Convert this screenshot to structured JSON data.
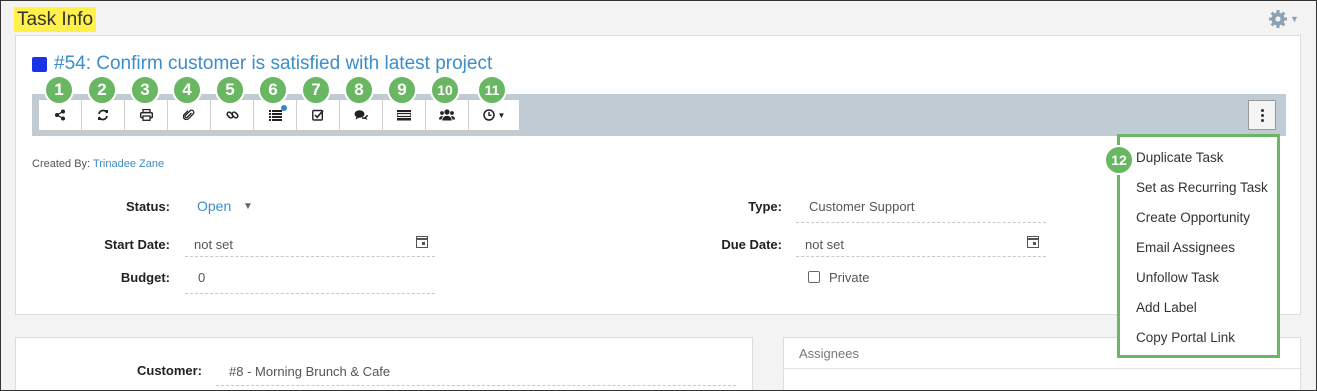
{
  "page": {
    "title": "Task Info"
  },
  "task": {
    "color": "#1a33e6",
    "title": "#54: Confirm customer is satisfied with latest project",
    "created_by_label": "Created By:",
    "created_by": "Trinadee Zane"
  },
  "toolbar": {
    "band_color": "#c0cbd4",
    "badge_color": "#6ab763",
    "buttons": [
      {
        "badge": "1",
        "icon": "share-icon"
      },
      {
        "badge": "2",
        "icon": "refresh-icon"
      },
      {
        "badge": "3",
        "icon": "print-icon"
      },
      {
        "badge": "4",
        "icon": "paperclip-icon"
      },
      {
        "badge": "5",
        "icon": "link-icon"
      },
      {
        "badge": "6",
        "icon": "list-icon"
      },
      {
        "badge": "7",
        "icon": "checkbox-icon"
      },
      {
        "badge": "8",
        "icon": "comments-icon"
      },
      {
        "badge": "9",
        "icon": "form-icon"
      },
      {
        "badge": "10",
        "icon": "users-icon"
      },
      {
        "badge": "11",
        "icon": "clock-dropdown-icon"
      }
    ]
  },
  "more_menu": {
    "badge": "12",
    "items": [
      "Duplicate Task",
      "Set as Recurring Task",
      "Create Opportunity",
      "Email Assignees",
      "Unfollow Task",
      "Add Label",
      "Copy Portal Link"
    ]
  },
  "fields": {
    "status_label": "Status:",
    "status_value": "Open",
    "start_label": "Start Date:",
    "start_value": "not set",
    "budget_label": "Budget:",
    "budget_value": "0",
    "type_label": "Type:",
    "type_value": "Customer Support",
    "due_label": "Due Date:",
    "due_value": "not set",
    "private_label": "Private"
  },
  "customer": {
    "label": "Customer:",
    "value": "#8 - Morning Brunch & Cafe"
  },
  "assignees": {
    "label": "Assignees"
  }
}
